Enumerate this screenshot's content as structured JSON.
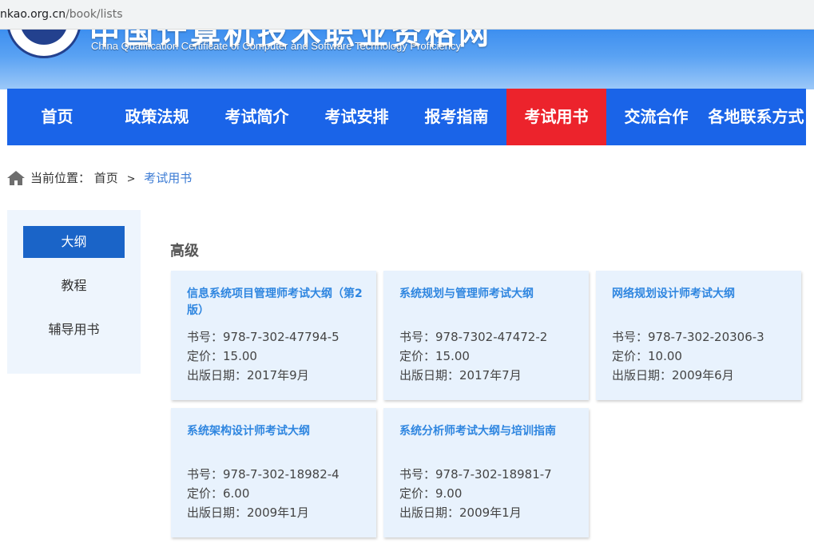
{
  "browser": {
    "url_host": "nkao.org.cn",
    "url_path": "/book/lists"
  },
  "banner": {
    "title_cn": "中国计算机技术职业资格网",
    "subtitle": "China Qualification Certificate of Computer and Software Technology Proficiency"
  },
  "nav": {
    "items": [
      {
        "label": "首页"
      },
      {
        "label": "政策法规"
      },
      {
        "label": "考试简介"
      },
      {
        "label": "考试安排"
      },
      {
        "label": "报考指南"
      },
      {
        "label": "考试用书",
        "active": true
      },
      {
        "label": "交流合作"
      },
      {
        "label": "各地联系方式"
      }
    ]
  },
  "breadcrumb": {
    "prefix": "当前位置：",
    "home": "首页",
    "separator": ">",
    "current": "考试用书"
  },
  "sidebar": {
    "items": [
      {
        "label": "大纲",
        "active": true
      },
      {
        "label": "教程"
      },
      {
        "label": "辅导用书"
      }
    ]
  },
  "section": {
    "title": "高级"
  },
  "books": [
    {
      "title": "信息系统项目管理师考试大纲（第2版）",
      "isbn": "书号：978-7-302-47794-5",
      "price": "定价：15.00",
      "date": "出版日期：2017年9月"
    },
    {
      "title": "系统规划与管理师考试大纲",
      "isbn": "书号：978-7302-47472-2",
      "price": "定价：15.00",
      "date": "出版日期：2017年7月"
    },
    {
      "title": "网络规划设计师考试大纲",
      "isbn": "书号：978-7-302-20306-3",
      "price": "定价：10.00",
      "date": "出版日期：2009年6月"
    },
    {
      "title": "系统架构设计师考试大纲",
      "isbn": "书号：978-7-302-18982-4",
      "price": "定价：6.00",
      "date": "出版日期：2009年1月"
    },
    {
      "title": "系统分析师考试大纲与培训指南",
      "isbn": "书号：978-7-302-18981-7",
      "price": "定价：9.00",
      "date": "出版日期：2009年1月"
    }
  ],
  "colors": {
    "nav_bg": "#1a64e8",
    "nav_active": "#ec232c",
    "card_bg": "#e8f2fd",
    "card_title": "#2f86e0",
    "breadcrumb_current": "#3b7bd4"
  }
}
